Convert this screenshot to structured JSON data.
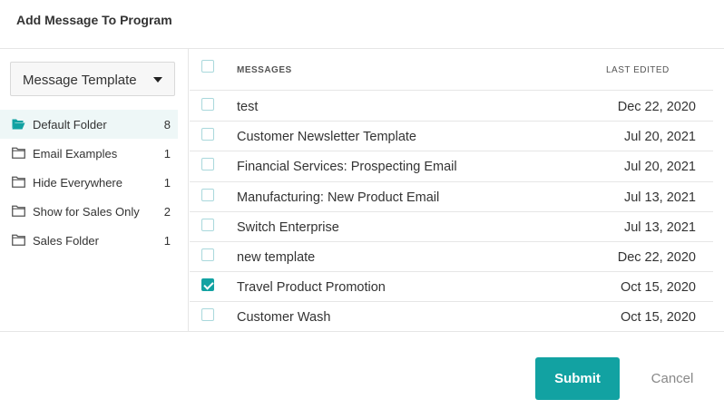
{
  "dialog": {
    "title": "Add Message To Program"
  },
  "sidebar": {
    "dropdown_label": "Message Template",
    "folders": [
      {
        "name": "Default Folder",
        "count": "8",
        "icon": "folder-open-icon",
        "active": true
      },
      {
        "name": "Email Examples",
        "count": "1",
        "icon": "folder-icon",
        "active": false
      },
      {
        "name": "Hide Everywhere",
        "count": "1",
        "icon": "folder-icon",
        "active": false
      },
      {
        "name": "Show for Sales Only",
        "count": "2",
        "icon": "folder-icon",
        "active": false
      },
      {
        "name": "Sales Folder",
        "count": "1",
        "icon": "folder-icon",
        "active": false
      }
    ]
  },
  "table": {
    "header_messages": "MESSAGES",
    "header_last_edited": "LAST EDITED",
    "rows": [
      {
        "name": "test",
        "date": "Dec 22, 2020",
        "checked": false
      },
      {
        "name": "Customer Newsletter Template",
        "date": "Jul 20, 2021",
        "checked": false
      },
      {
        "name": "Financial Services: Prospecting Email",
        "date": "Jul 20, 2021",
        "checked": false
      },
      {
        "name": "Manufacturing: New Product Email",
        "date": "Jul 13, 2021",
        "checked": false
      },
      {
        "name": "Switch Enterprise",
        "date": "Jul 13, 2021",
        "checked": false
      },
      {
        "name": "new template",
        "date": "Dec 22, 2020",
        "checked": false
      },
      {
        "name": "Travel Product Promotion",
        "date": "Oct 15, 2020",
        "checked": true
      },
      {
        "name": "Customer Wash",
        "date": "Oct 15, 2020",
        "checked": false
      }
    ]
  },
  "footer": {
    "submit_label": "Submit",
    "cancel_label": "Cancel"
  },
  "colors": {
    "accent": "#12a2a2",
    "active_folder_bg": "#eef7f7",
    "checkbox_border": "#a9d8dc"
  }
}
